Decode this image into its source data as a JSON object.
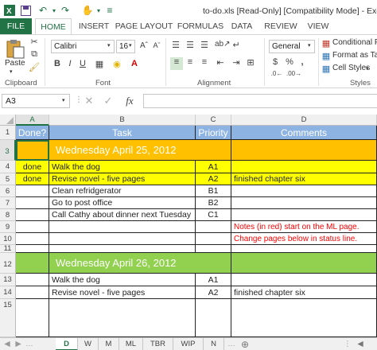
{
  "window": {
    "title": "to-do.xls [Read-Only] [Compatibility Mode] - Excel"
  },
  "ribbon_tabs": [
    "FILE",
    "HOME",
    "INSERT",
    "PAGE LAYOUT",
    "FORMULAS",
    "DATA",
    "REVIEW",
    "VIEW"
  ],
  "ribbon": {
    "clipboard": {
      "paste_label": "Paste",
      "group_label": "Clipboard"
    },
    "font": {
      "font_name": "Calibri",
      "font_size": "16",
      "bold": "B",
      "italic": "I",
      "underline": "U",
      "group_label": "Font"
    },
    "alignment": {
      "group_label": "Alignment"
    },
    "number": {
      "format": "General",
      "currency": "$",
      "percent": "%",
      "comma": ","
    },
    "styles": {
      "conditional": "Conditional Fo",
      "format_table": "Format as Tab",
      "cell_styles": "Cell Styles",
      "group_label": "Styles"
    }
  },
  "formula_bar": {
    "name_box": "A3",
    "fx": "fx",
    "value": ""
  },
  "colors": {
    "header_blue": "#8db3e2",
    "date_orange": "#ffc000",
    "done_yellow": "#ffff00",
    "date_green": "#92d050",
    "note_red": "#ff0000",
    "excel_green": "#217346"
  },
  "columns": [
    "A",
    "B",
    "C",
    "D"
  ],
  "rows": [
    {
      "num": "1",
      "a": "Done?",
      "b": "Task",
      "c": "Priority",
      "d": "Comments"
    },
    {
      "num": "3",
      "date": "Wednesday April 25, 2012"
    },
    {
      "num": "4",
      "a": "done",
      "b": "Walk the dog",
      "c": "A1",
      "d": ""
    },
    {
      "num": "5",
      "a": "done",
      "b": "Revise novel - five pages",
      "c": "A2",
      "d": "finished chapter six"
    },
    {
      "num": "6",
      "a": "",
      "b": "Clean refridgerator",
      "c": "B1",
      "d": ""
    },
    {
      "num": "7",
      "a": "",
      "b": "Go to post office",
      "c": "B2",
      "d": ""
    },
    {
      "num": "8",
      "a": "",
      "b": "Call Cathy about dinner next Tuesday",
      "c": "C1",
      "d": ""
    },
    {
      "num": "9",
      "a": "",
      "b": "",
      "c": "",
      "d": "Notes (in red) start on the ML page."
    },
    {
      "num": "10",
      "a": "",
      "b": "",
      "c": "",
      "d": "Change pages below in status line."
    },
    {
      "num": "11",
      "a": "",
      "b": "",
      "c": "",
      "d": ""
    },
    {
      "num": "12",
      "date": "Wednesday April 26, 2012"
    },
    {
      "num": "13",
      "a": "",
      "b": "Walk the dog",
      "c": "A1",
      "d": ""
    },
    {
      "num": "14",
      "a": "",
      "b": "Revise novel - five pages",
      "c": "A2",
      "d": "finished chapter six"
    },
    {
      "num": "15",
      "a": "",
      "b": "",
      "c": "",
      "d": ""
    }
  ],
  "sheet_tabs": [
    "D",
    "W",
    "M",
    "ML",
    "TBR",
    "WIP",
    "N"
  ],
  "active_sheet": "D"
}
